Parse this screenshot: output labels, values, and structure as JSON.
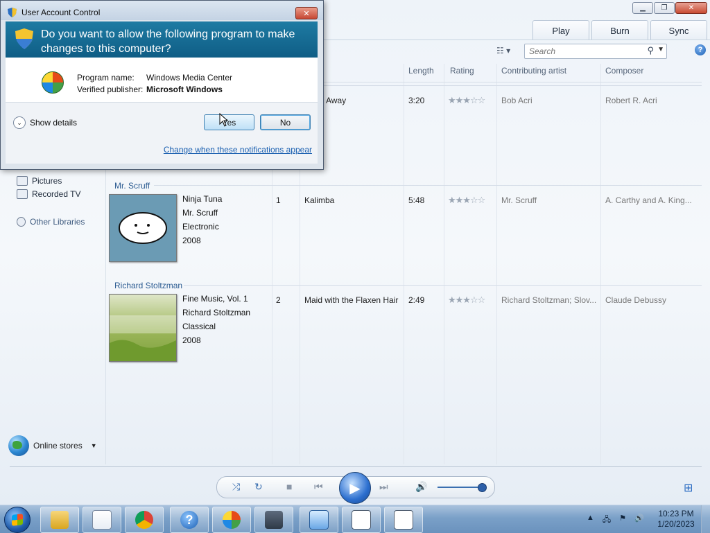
{
  "wmp": {
    "tabs": [
      "Play",
      "Burn",
      "Sync"
    ],
    "search_placeholder": "Search",
    "columns": {
      "length": "Length",
      "rating": "Rating",
      "contributing_artist": "Contributing artist",
      "composer": "Composer"
    },
    "nav": {
      "pictures": "Pictures",
      "recorded_tv": "Recorded TV",
      "other_libraries": "Other Libraries",
      "online_stores": "Online stores"
    },
    "rows": [
      {
        "title_partial": "Away",
        "length": "3:20",
        "contributing_artist": "Bob Acri",
        "composer": "Robert R. Acri",
        "rating": 3
      },
      {
        "group": "Mr. Scruff",
        "album": "Ninja Tuna",
        "album_artist": "Mr. Scruff",
        "genre": "Electronic",
        "year": "2008",
        "track": "1",
        "title": "Kalimba",
        "length": "5:48",
        "contributing_artist": "Mr. Scruff",
        "composer": "A. Carthy and A. King...",
        "rating": 3
      },
      {
        "group": "Richard Stoltzman",
        "album": "Fine Music, Vol. 1",
        "album_artist": "Richard Stoltzman",
        "genre": "Classical",
        "year": "2008",
        "track": "2",
        "title": "Maid with the Flaxen Hair",
        "length": "2:49",
        "contributing_artist": "Richard Stoltzman; Slov...",
        "composer": "Claude Debussy",
        "rating": 3
      }
    ]
  },
  "uac": {
    "title": "User Account Control",
    "question": "Do you want to allow the following program to make changes to this computer?",
    "program_name_label": "Program name:",
    "program_name": "Windows Media Center",
    "publisher_label": "Verified publisher:",
    "publisher": "Microsoft Windows",
    "show_details": "Show details",
    "yes": "Yes",
    "no": "No",
    "notify_link": "Change when these notifications appear"
  },
  "taskbar": {
    "time": "10:23 PM",
    "date": "1/20/2023"
  }
}
